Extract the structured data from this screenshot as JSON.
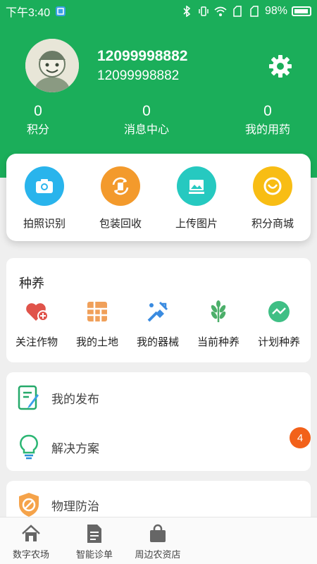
{
  "status_bar": {
    "time": "下午3:40",
    "battery": "98%"
  },
  "profile": {
    "name": "12099998882",
    "account": "12099998882"
  },
  "stats": [
    {
      "value": "0",
      "label": "积分"
    },
    {
      "value": "0",
      "label": "消息中心"
    },
    {
      "value": "0",
      "label": "我的用药"
    }
  ],
  "quick_actions": [
    {
      "label": "拍照识别",
      "icon": "camera-icon",
      "color": "#29b4ec"
    },
    {
      "label": "包装回收",
      "icon": "recycle-icon",
      "color": "#f39a2c"
    },
    {
      "label": "上传图片",
      "icon": "image-upload-icon",
      "color": "#26c9c0"
    },
    {
      "label": "积分商城",
      "icon": "points-mall-icon",
      "color": "#f8bd14"
    }
  ],
  "farming": {
    "title": "种养",
    "items": [
      {
        "label": "关注作物",
        "icon": "heart-plus-icon"
      },
      {
        "label": "我的土地",
        "icon": "land-grid-icon"
      },
      {
        "label": "我的器械",
        "icon": "tools-icon"
      },
      {
        "label": "当前种养",
        "icon": "plant-icon"
      },
      {
        "label": "计划种养",
        "icon": "trend-icon"
      }
    ]
  },
  "menu": [
    {
      "label": "我的发布",
      "icon": "publish-icon"
    },
    {
      "label": "解决方案",
      "icon": "lightbulb-icon",
      "badge": "4"
    }
  ],
  "menu2": [
    {
      "label": "物理防治",
      "icon": "shield-icon"
    }
  ],
  "tabs": [
    {
      "label": "数字农场",
      "icon": "home-icon"
    },
    {
      "label": "智能诊单",
      "icon": "document-icon"
    },
    {
      "label": "周边农资店",
      "icon": "shopping-bag-icon"
    }
  ],
  "colors": {
    "brand": "#1bae5a",
    "badge": "#f2611a"
  }
}
